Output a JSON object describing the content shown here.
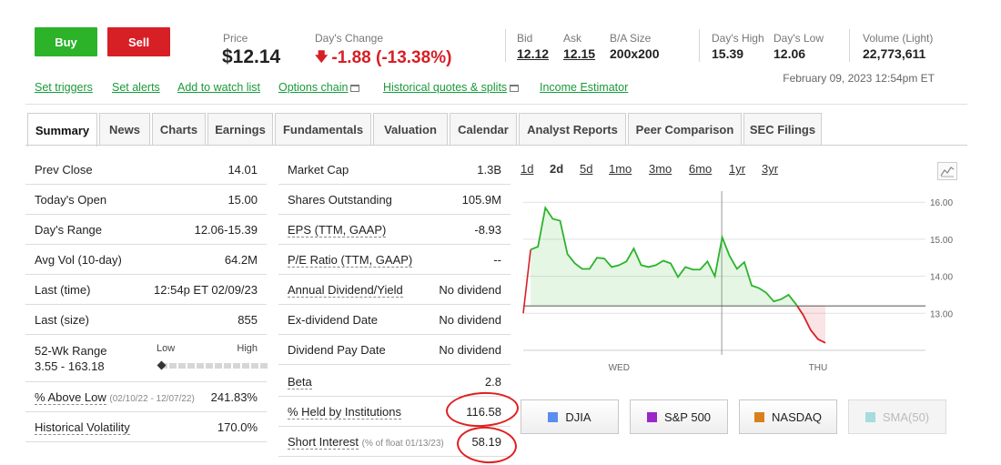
{
  "actions": {
    "buy": "Buy",
    "sell": "Sell"
  },
  "quote": {
    "price_label": "Price",
    "price": "$12.14",
    "change_label": "Day's Change",
    "change": "-1.88 (-13.38%)",
    "bid_label": "Bid",
    "bid": "12.12",
    "ask_label": "Ask",
    "ask": "12.15",
    "ba_size_label": "B/A Size",
    "ba_size": "200x200",
    "high_label": "Day's High",
    "high": "15.39",
    "low_label": "Day's Low",
    "low": "12.06",
    "volume_label": "Volume (Light)",
    "volume": "22,773,611",
    "datetime": "February 09, 2023 12:54pm ET",
    "colors": {
      "up": "#2cb32a",
      "down": "#d71f26",
      "link": "#1a9a3a"
    }
  },
  "links": [
    "Set triggers",
    "Set alerts",
    "Add to watch list",
    "Options chain",
    "Historical quotes & splits",
    "Income Estimator"
  ],
  "tabs": [
    "Summary",
    "News",
    "Charts",
    "Earnings",
    "Fundamentals",
    "Valuation",
    "Calendar",
    "Analyst Reports",
    "Peer Comparison",
    "SEC Filings"
  ],
  "active_tab": "Summary",
  "left_table": [
    {
      "label": "Prev Close",
      "value": "14.01"
    },
    {
      "label": "Today's Open",
      "value": "15.00"
    },
    {
      "label": "Day's Range",
      "value": "12.06-15.39"
    },
    {
      "label": "Avg Vol (10-day)",
      "value": "64.2M"
    },
    {
      "label": "Last (time)",
      "value": "12:54p ET 02/09/23"
    },
    {
      "label": "Last (size)",
      "value": "855"
    },
    {
      "label": "52-Wk Range",
      "value": "3.55 - 163.18",
      "low_label": "Low",
      "high_label": "High",
      "position_pct": 0
    },
    {
      "label": "% Above Low",
      "note": "(02/10/22 - 12/07/22)",
      "value": "241.83%"
    },
    {
      "label": "Historical Volatility",
      "value": "170.0%"
    }
  ],
  "mid_table": [
    {
      "label": "Market Cap",
      "value": "1.3B"
    },
    {
      "label": "Shares Outstanding",
      "value": "105.9M"
    },
    {
      "label": "EPS (TTM, GAAP)",
      "value": "-8.93"
    },
    {
      "label": "P/E Ratio (TTM, GAAP)",
      "value": "--"
    },
    {
      "label": "Annual Dividend/Yield",
      "value": "No dividend"
    },
    {
      "label": "Ex-dividend Date",
      "value": "No dividend"
    },
    {
      "label": "Dividend Pay Date",
      "value": "No dividend"
    },
    {
      "label": "Beta",
      "value": "2.8"
    },
    {
      "label": "% Held by Institutions",
      "value": "116.58"
    },
    {
      "label": "Short Interest",
      "note": "(% of float 01/13/23)",
      "value": "58.19"
    }
  ],
  "chart_controls": {
    "periods": [
      "1d",
      "2d",
      "5d",
      "1mo",
      "3mo",
      "6mo",
      "1yr",
      "3yr"
    ],
    "active_period": "2d",
    "compare": [
      {
        "label": "DJIA",
        "color": "#5b8def"
      },
      {
        "label": "S&P 500",
        "color": "#9b27c7"
      },
      {
        "label": "NASDAQ",
        "color": "#d9801c"
      },
      {
        "label": "SMA(50)",
        "color": "#a6dcdc",
        "disabled": true
      }
    ]
  },
  "chart_data": {
    "type": "line",
    "x_labels": [
      "WED",
      "THU"
    ],
    "y_ticks": [
      "13.00",
      "14.00",
      "15.00",
      "16.00"
    ],
    "ylim": [
      12.0,
      16.3
    ],
    "reference_line": 13.2,
    "grid": true,
    "series": [
      {
        "values": [
          13.0,
          14.72,
          14.8,
          15.85,
          15.55,
          15.5,
          14.6,
          14.35,
          14.2,
          14.2,
          14.5,
          14.48,
          14.25,
          14.3,
          14.4,
          14.75,
          14.3,
          14.25,
          14.3,
          14.42,
          14.35,
          13.98,
          14.25,
          14.18,
          14.18,
          14.4,
          14.0,
          15.05,
          14.55,
          14.2,
          14.38,
          13.75,
          13.68,
          13.55,
          13.32,
          13.38,
          13.5,
          13.25,
          12.95,
          12.55,
          12.3,
          12.2
        ]
      }
    ]
  }
}
